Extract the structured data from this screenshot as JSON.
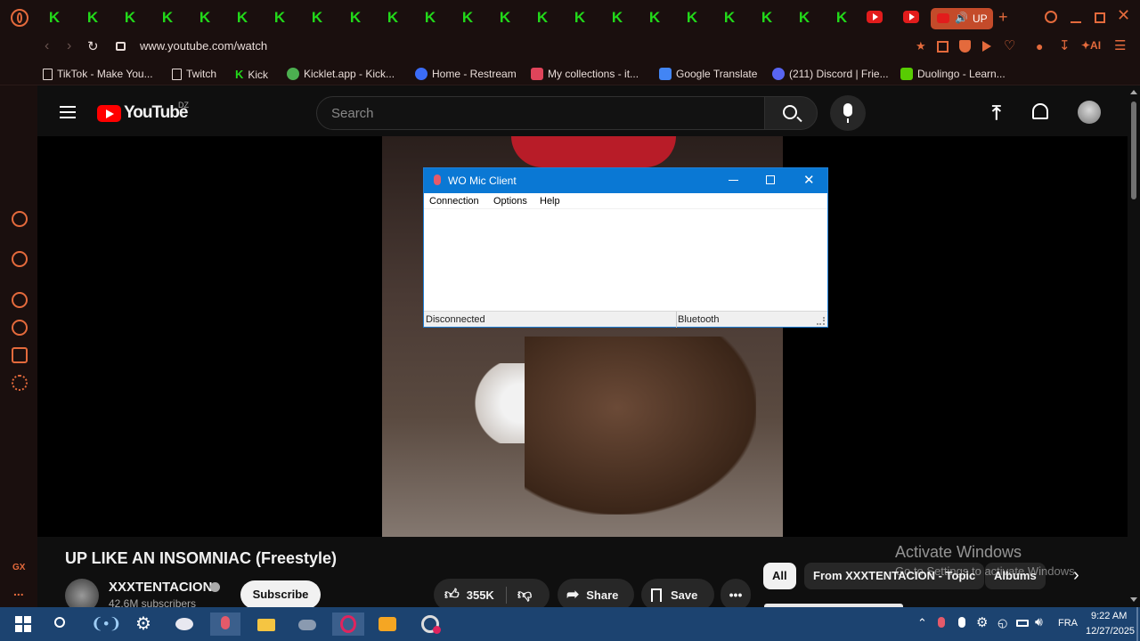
{
  "browser": {
    "url": "www.youtube.com/watch",
    "active_tab_label": "UP",
    "bookmarks": [
      {
        "label": "TikTok - Make You...",
        "color": "#ffffff"
      },
      {
        "label": "Twitch",
        "color": "#ffffff"
      },
      {
        "label": "Kick",
        "color": "#22d81a"
      },
      {
        "label": "Kicklet.app - Kick...",
        "color": "#4caf50"
      },
      {
        "label": "Home - Restream",
        "color": "#3b6cf6"
      },
      {
        "label": "My collections - it...",
        "color": "#e0445a"
      },
      {
        "label": "Google Translate",
        "color": "#4285f4"
      },
      {
        "label": "(211) Discord | Frie...",
        "color": "#5865f2"
      },
      {
        "label": "Duolingo - Learn...",
        "color": "#58cc02"
      }
    ]
  },
  "youtube": {
    "logo_text": "YouTube",
    "country_code": "DZ",
    "search_placeholder": "Search",
    "video_title": "UP LIKE AN INSOMNIAC (Freestyle)",
    "channel_name": "XXXTENTACION",
    "subscribers": "42.6M subscribers",
    "subscribe_label": "Subscribe",
    "likes": "355K",
    "share_label": "Share",
    "save_label": "Save",
    "chips": [
      "All",
      "From XXXTENTACION - Topic",
      "Albums"
    ]
  },
  "wo_mic": {
    "title": "WO Mic Client",
    "menu": [
      "Connection",
      "Options",
      "Help"
    ],
    "status_left": "Disconnected",
    "status_right": "Bluetooth"
  },
  "watermark": {
    "line1": "Activate Windows",
    "line2": "Go to Settings to activate Windows."
  },
  "sidebar": {
    "gx_label": "GX",
    "more_label": "..."
  },
  "taskbar": {
    "language": "FRA",
    "time": "9:22 AM",
    "date": "12/27/2025"
  }
}
